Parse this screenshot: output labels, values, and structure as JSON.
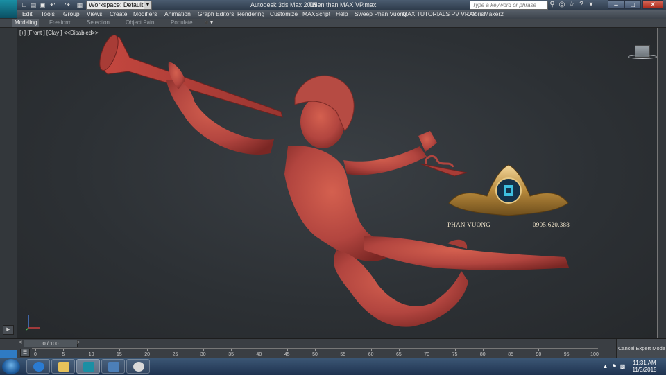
{
  "window": {
    "app_title": "Autodesk 3ds Max  2015",
    "file_title": "Thien than MAX VP.max",
    "app_logo_text": "MAX",
    "workspace_label": "Workspace: Default",
    "search_placeholder": "Type a keyword or phrase",
    "minimize": "–",
    "maximize": "□",
    "close": "✕"
  },
  "menu": {
    "items": [
      "Edit",
      "Tools",
      "Group",
      "Views",
      "Create",
      "Modifiers",
      "Animation",
      "Graph Editors",
      "Rendering",
      "Customize",
      "MAXScript",
      "Help",
      "Sweep Phan Vuong",
      "MAX TUTORIALS PV VRAY",
      "DebrisMaker2"
    ]
  },
  "ribbon": {
    "tabs": [
      "Modeling",
      "Freeform",
      "Selection",
      "Object Paint",
      "Populate"
    ],
    "active": "Modeling"
  },
  "viewport": {
    "label": "[+] [Front ] [Clay ]  <<Disabled>>",
    "clay_color": "#b2453f",
    "watermark_name": "PHAN VUONG",
    "watermark_phone": "0905.620.388"
  },
  "timeline": {
    "frame_counter": "0 / 100",
    "ticks": [
      "0",
      "5",
      "10",
      "15",
      "20",
      "25",
      "30",
      "35",
      "40",
      "45",
      "50",
      "55",
      "60",
      "65",
      "70",
      "75",
      "80",
      "85",
      "90",
      "95",
      "100"
    ],
    "cancel_label": "Cancel Expert Mode"
  },
  "taskbar": {
    "time": "11:31 AM",
    "date": "11/3/2015"
  },
  "colors": {
    "accent": "#2f7bc4",
    "viewport_bg": "#2c3034"
  }
}
